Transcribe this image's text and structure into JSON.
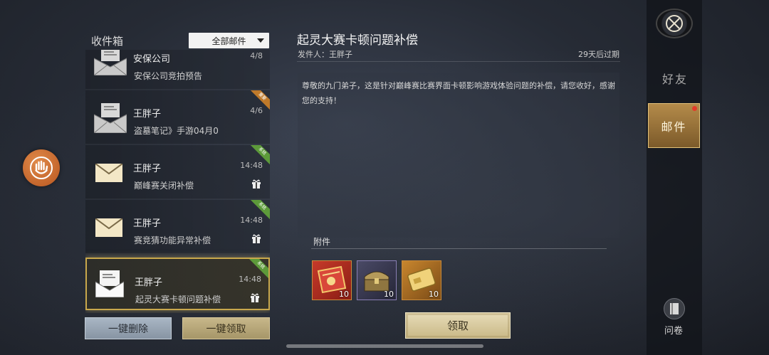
{
  "inbox": {
    "title": "收件箱",
    "filter": "全部邮件",
    "items": [
      {
        "sender": "安保公司",
        "subject": "安保公司竞拍预告",
        "time": "4/8",
        "badge": "",
        "gift": false
      },
      {
        "sender": "王胖子",
        "subject": "盗墓笔记》手游04月0",
        "time": "4/6",
        "badge": "重要",
        "gift": false
      },
      {
        "sender": "王胖子",
        "subject": "巅峰赛关闭补偿",
        "time": "14:48",
        "badge": "系统",
        "gift": true
      },
      {
        "sender": "王胖子",
        "subject": "赛竞猜功能异常补偿",
        "time": "14:48",
        "badge": "系统",
        "gift": true
      },
      {
        "sender": "王胖子",
        "subject": "起灵大赛卡顿问题补偿",
        "time": "14:48",
        "badge": "系统",
        "gift": true
      }
    ],
    "delete_all": "一键删除",
    "claim_all": "一键领取"
  },
  "mail": {
    "title": "起灵大赛卡顿问题补偿",
    "sender_label": "发件人：王胖子",
    "expire": "29天后过期",
    "body": "尊敬的九门弟子，这是针对巅峰赛比赛界面卡顿影响游戏体验问题的补偿，请您收好，感谢您的支持！",
    "attachments_label": "附件",
    "attachments": [
      {
        "icon": "red-ticket-icon",
        "qty": "10"
      },
      {
        "icon": "treasure-chest-icon",
        "qty": "10"
      },
      {
        "icon": "gold-card-icon",
        "qty": "10"
      }
    ],
    "claim": "领取"
  },
  "nav": {
    "friends": "好友",
    "mail": "邮件",
    "survey": "问卷"
  },
  "colors": {
    "accent_gold": "#c9a84c",
    "badge_green": "#5d9a3a",
    "badge_orange": "#c07a2a",
    "notify_red": "#e23a2a"
  }
}
